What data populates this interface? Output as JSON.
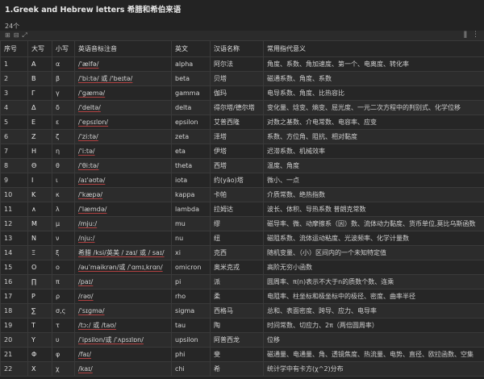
{
  "header": {
    "title": "1.Greek and Hebrew letters  希腊和希伯来语",
    "count": "24个"
  },
  "toolbar": {
    "left_icons": [
      "grid-icon",
      "collapse-icon",
      "expand-icon"
    ],
    "right_icons": [
      "info-icon",
      "more-icon"
    ]
  },
  "table": {
    "columns": [
      "序号",
      "大写",
      "小写",
      "英语音标注音",
      "英文",
      "汉语名称",
      "常用指代意义"
    ],
    "rows": [
      [
        "1",
        "A",
        "α",
        "/'ælfə/",
        "alpha",
        "阿尔法",
        "角度、系数、角加速度、第一个、电离度、转化率"
      ],
      [
        "2",
        "B",
        "β",
        "/'bi:tə/ 或 /'beɪtə/",
        "beta",
        "贝塔",
        "磁通系数、角度、系数"
      ],
      [
        "3",
        "Γ",
        "γ",
        "/'gæmə/",
        "gamma",
        "伽玛",
        "电导系数、角度、比热容比"
      ],
      [
        "4",
        "Δ",
        "δ",
        "/'deltə/",
        "delta",
        "得尔塔/德尔塔",
        "变化量、焓变、熵变、屈光度、一元二次方程中的判别式、化学位移"
      ],
      [
        "5",
        "Ε",
        "ε",
        "/'epsɪlɒn/",
        "epsilon",
        "艾普西隆",
        "对数之基数、介电常数、电容率、应变"
      ],
      [
        "6",
        "Ζ",
        "ζ",
        "/'zi:tə/",
        "zeta",
        "泽塔",
        "系数、方位角、阻抗、相对黏度"
      ],
      [
        "7",
        "Η",
        "η",
        "/'i:tə/",
        "eta",
        "伊塔",
        "迟滞系数、机械效率"
      ],
      [
        "8",
        "Θ",
        "θ",
        "/'θi:tə/",
        "theta",
        "西塔",
        "温度、角度"
      ],
      [
        "9",
        "Ι",
        "ι",
        "/aɪ'əʊtə/",
        "iota",
        "约(yāo)塔",
        "微小、一点"
      ],
      [
        "10",
        "Κ",
        "κ",
        "/'kæpə/",
        "kappa",
        "卡帕",
        "介质常数、绝热指数"
      ],
      [
        "11",
        "∧",
        "λ",
        "/'læmdə/",
        "lambda",
        "拉姆达",
        "波长、体积、导热系数 普朗克常数"
      ],
      [
        "12",
        "Μ",
        "μ",
        "/mju:/",
        "mu",
        "缪",
        "磁导率、微、动摩擦系（因）数、流体动力黏度、货币单位,莫比乌斯函数"
      ],
      [
        "13",
        "Ν",
        "ν",
        "/nju:/",
        "nu",
        "纽",
        "磁阻系数、流体运动粘度、光波频率、化学计量数"
      ],
      [
        "14",
        "Ξ",
        "ξ",
        "希腊 /ksi/英美 / zaɪ/ 或 / saɪ/",
        "xi",
        "克西",
        "随机变量、（小）区间内的一个未知特定值"
      ],
      [
        "15",
        "Ο",
        "ο",
        "/əuˈmaikrən/或 /ˈɑmɪˌkrɑn/",
        "omicron",
        "奥米克戎",
        "高阶无穷小函数"
      ],
      [
        "16",
        "∏",
        "π",
        "/paɪ/",
        "pi",
        "派",
        "圆周率、π(n)表示不大于n的质数个数、连乘"
      ],
      [
        "17",
        "Ρ",
        "ρ",
        "/rəʊ/",
        "rho",
        "柔",
        "电阻率、柱坐标和极坐标中的极径、密度、曲率半径"
      ],
      [
        "18",
        "∑",
        "σ,ς",
        "/'sɪɡmə/",
        "sigma",
        "西格马",
        "总和、表面密度、跨导、应力、电导率"
      ],
      [
        "19",
        "Τ",
        "τ",
        "/tɔ:/ 或 /taʊ/",
        "tau",
        "陶",
        "时间常数、切应力、2π（两倍圆周率）"
      ],
      [
        "20",
        "Υ",
        "υ",
        "/ˈipsilon/或 /ˈʌpsɪlɒn/",
        "upsilon",
        "阿普西龙",
        "位移"
      ],
      [
        "21",
        "Φ",
        "φ",
        "/faɪ/",
        "phi",
        "斐",
        "磁通量、电通量、角、透镜焦度、热流量、电势、直径、欧拉函数、空集"
      ],
      [
        "22",
        "Χ",
        "χ",
        "/kaɪ/",
        "chi",
        "希",
        "统计学中有卡方(χ^2)分布"
      ]
    ]
  }
}
